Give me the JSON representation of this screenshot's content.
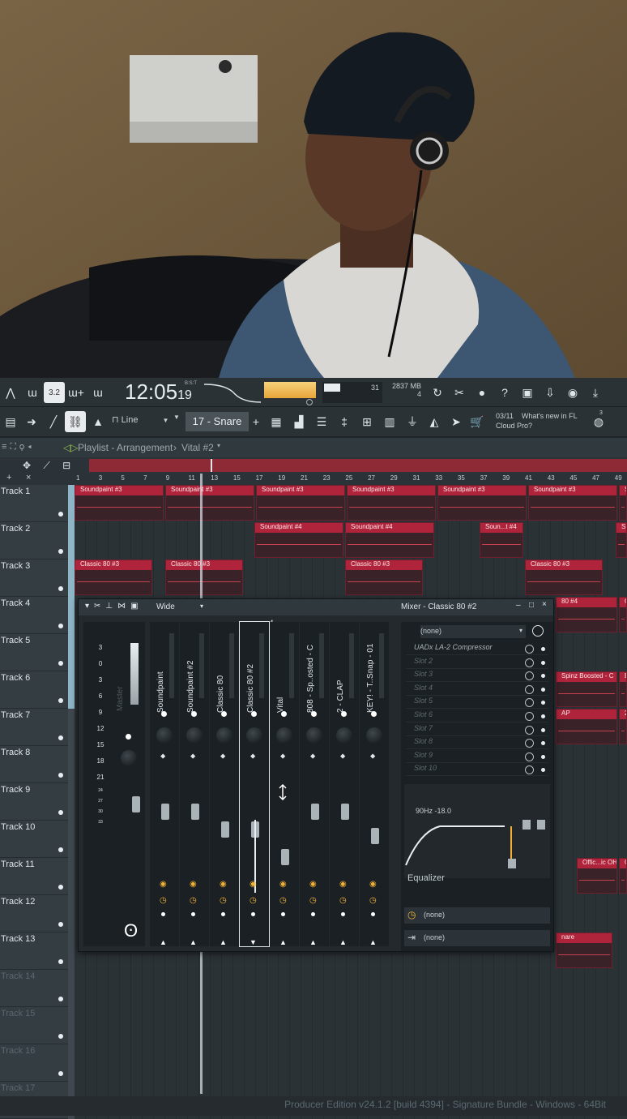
{
  "toolbar": {
    "time_display": "12:05",
    "time_sub": "19",
    "time_mode": "B:S:T",
    "tempo_indicator": "3.2",
    "cpu": "31",
    "memory": "2837 MB",
    "polyphony": "4",
    "snap_mode": "Line",
    "pattern": "17 - Snare",
    "news_counter": "03/11",
    "news_text_1": "What's new in FL",
    "news_text_2": "Cloud Pro?",
    "news_badge": "3"
  },
  "playlist": {
    "title": "Playlist - Arrangement",
    "pattern": "Vital #2",
    "ruler": [
      "1",
      "3",
      "5",
      "7",
      "9",
      "11",
      "13",
      "15",
      "17",
      "19",
      "21",
      "23",
      "25",
      "27",
      "29",
      "31",
      "33",
      "35",
      "37",
      "39",
      "41",
      "43",
      "45",
      "47",
      "49"
    ],
    "tracks": [
      {
        "label": "Track 1"
      },
      {
        "label": "Track 2"
      },
      {
        "label": "Track 3"
      },
      {
        "label": "Track 4"
      },
      {
        "label": "Track 5"
      },
      {
        "label": "Track 6"
      },
      {
        "label": "Track 7"
      },
      {
        "label": "Track 8"
      },
      {
        "label": "Track 9"
      },
      {
        "label": "Track 10"
      },
      {
        "label": "Track 11"
      },
      {
        "label": "Track 12"
      },
      {
        "label": "Track 13"
      },
      {
        "label": "Track 14"
      },
      {
        "label": "Track 15"
      },
      {
        "label": "Track 16"
      },
      {
        "label": "Track 17"
      }
    ],
    "clips": {
      "t1": [
        "Soundpaint #3",
        "Soundpaint #3",
        "Soundpaint #3",
        "Soundpaint #3",
        "Soundpaint #3",
        "Soundpaint #3",
        "S"
      ],
      "t2": [
        "Soundpaint #4",
        "Soundpaint #4",
        "Soun...t #4",
        "S"
      ],
      "t3": [
        "Classic 80 #3",
        "Classic 80 #3",
        "Classic 80 #3",
        "Classic 80 #3"
      ],
      "t4": [
        "80 #4",
        "C"
      ],
      "t6": [
        "Spinz Boosted - C",
        "B"
      ],
      "t7": [
        "AP",
        "2"
      ],
      "t11": [
        "Offic...ic OH",
        "O"
      ],
      "t13": [
        "nare"
      ]
    }
  },
  "mixer": {
    "view_mode": "Wide",
    "title": "Mixer - Classic 80 #2",
    "preset": "(none)",
    "current_insert": "4",
    "master_label": "Master",
    "master_scale": [
      "3",
      "0",
      "3",
      "6",
      "9",
      "12",
      "15",
      "18",
      "21",
      "24",
      "27",
      "30",
      "33"
    ],
    "strips": [
      {
        "name": "Soundpaint"
      },
      {
        "name": "Soundpaint #2"
      },
      {
        "name": "Classic 80"
      },
      {
        "name": "Classic 80 #2"
      },
      {
        "name": "Vital"
      },
      {
        "name": "808 - Sp..osted - C"
      },
      {
        "name": "2 - CLAP"
      },
      {
        "name": "KEY! - T..Snap - 01"
      }
    ],
    "slots": [
      "UADx LA-2 Compressor",
      "Slot 2",
      "Slot 3",
      "Slot 4",
      "Slot 5",
      "Slot 6",
      "Slot 7",
      "Slot 8",
      "Slot 9",
      "Slot 10"
    ],
    "eq_readout": "90Hz -18.0",
    "eq_label": "Equalizer",
    "input_route": "(none)",
    "output_route": "(none)",
    "accent": "#f2b134"
  },
  "statusbar": {
    "text": "Producer Edition v24.1.2 [build 4394] - Signature Bundle - Windows - 64Bit"
  }
}
